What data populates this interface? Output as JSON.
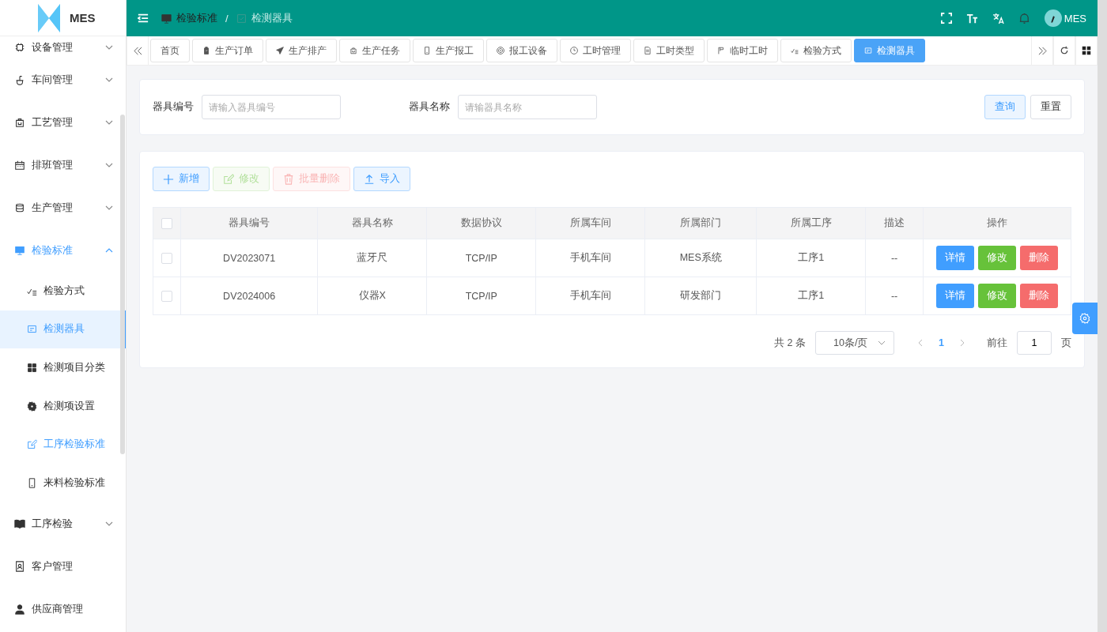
{
  "app": {
    "name": "MES"
  },
  "header": {
    "separator": "/",
    "breadcrumb": [
      {
        "label": "检验标准",
        "current": false
      },
      {
        "label": "检测器具",
        "current": true
      }
    ],
    "user": "MES"
  },
  "sidebar": {
    "items": [
      {
        "label": "设备管理",
        "expanded": false,
        "selected": false
      },
      {
        "label": "车间管理",
        "expanded": false,
        "selected": false
      },
      {
        "label": "工艺管理",
        "expanded": false,
        "selected": false
      },
      {
        "label": "排班管理",
        "expanded": false,
        "selected": false
      },
      {
        "label": "生产管理",
        "expanded": false,
        "selected": false
      },
      {
        "label": "检验标准",
        "expanded": true,
        "selected": true,
        "children": [
          {
            "label": "检验方式",
            "selected": false,
            "highlighted": false
          },
          {
            "label": "检测器具",
            "selected": true,
            "highlighted": false
          },
          {
            "label": "检测项目分类",
            "selected": false,
            "highlighted": false
          },
          {
            "label": "检测项设置",
            "selected": false,
            "highlighted": false
          },
          {
            "label": "工序检验标准",
            "selected": false,
            "highlighted": true
          },
          {
            "label": "来料检验标准",
            "selected": false,
            "highlighted": false
          }
        ]
      },
      {
        "label": "工序检验",
        "expanded": false,
        "selected": false
      },
      {
        "label": "客户管理",
        "selected": false
      },
      {
        "label": "供应商管理",
        "selected": false
      }
    ]
  },
  "tabs": [
    {
      "label": "首页",
      "selected": false
    },
    {
      "label": "生产订单",
      "selected": false
    },
    {
      "label": "生产排产",
      "selected": false
    },
    {
      "label": "生产任务",
      "selected": false
    },
    {
      "label": "生产报工",
      "selected": false
    },
    {
      "label": "报工设备",
      "selected": false
    },
    {
      "label": "工时管理",
      "selected": false
    },
    {
      "label": "工时类型",
      "selected": false
    },
    {
      "label": "临时工时",
      "selected": false
    },
    {
      "label": "检验方式",
      "selected": false
    },
    {
      "label": "检测器具",
      "selected": true
    }
  ],
  "search": {
    "fields": [
      {
        "label": "器具编号",
        "placeholder": "请输入器具编号"
      },
      {
        "label": "器具名称",
        "placeholder": "请输器具名称"
      }
    ],
    "buttons": [
      {
        "label": "查询",
        "kind": "primary"
      },
      {
        "label": "重置",
        "kind": "default"
      }
    ]
  },
  "toolbar": [
    {
      "label": "新增",
      "kind": "add",
      "disabled": false
    },
    {
      "label": "修改",
      "kind": "edit",
      "disabled": true
    },
    {
      "label": "批量删除",
      "kind": "delete",
      "disabled": true
    },
    {
      "label": "导入",
      "kind": "import",
      "disabled": false
    }
  ],
  "table": {
    "select_all": false,
    "columns": [
      "器具编号",
      "器具名称",
      "数据协议",
      "所属车间",
      "所属部门",
      "所属工序",
      "描述",
      "操作"
    ],
    "rows": [
      {
        "checked": false,
        "cells": [
          "DV2023071",
          "蓝牙尺",
          "TCP/IP",
          "手机车间",
          "MES系统",
          "工序1",
          "--"
        ],
        "actions": [
          {
            "label": "详情",
            "kind": "info"
          },
          {
            "label": "修改",
            "kind": "edit"
          },
          {
            "label": "删除",
            "kind": "delete"
          }
        ]
      },
      {
        "checked": false,
        "cells": [
          "DV2024006",
          "仪器X",
          "TCP/IP",
          "手机车间",
          "研发部门",
          "工序1",
          "--"
        ],
        "actions": [
          {
            "label": "详情",
            "kind": "info"
          },
          {
            "label": "修改",
            "kind": "edit"
          },
          {
            "label": "删除",
            "kind": "delete"
          }
        ]
      }
    ]
  },
  "pagination": {
    "total": "共 2 条",
    "page_size": "10条/页",
    "pages": [
      {
        "label": "1",
        "selected": true
      }
    ],
    "goto_label": "前往",
    "goto_value": "1",
    "page_suffix": "页"
  }
}
